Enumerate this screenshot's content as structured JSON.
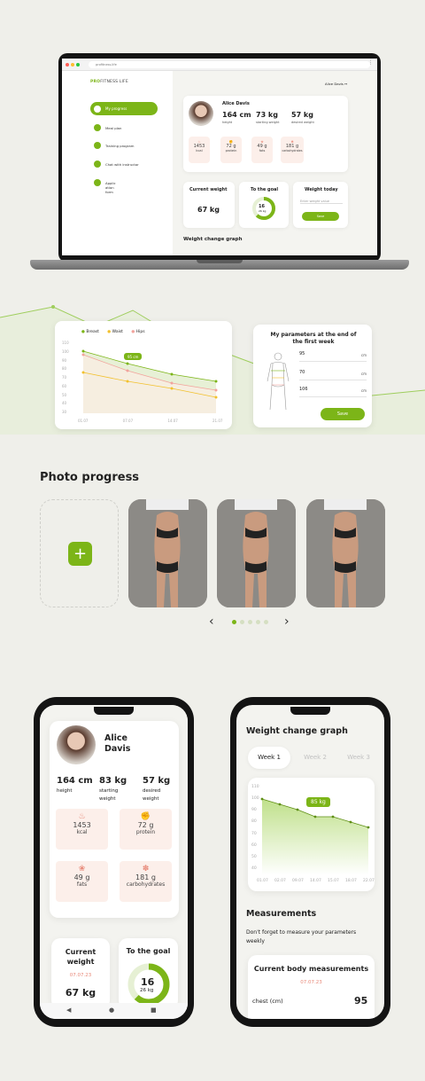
{
  "laptop": {
    "url": "profitness.life",
    "brand_prefix": "PRO",
    "brand_suffix": "FITNESS LIFE",
    "header_user": "Alice Davis",
    "nav": [
      "My progress",
      "Meal plan",
      "Training program",
      "Chat with instructor",
      "Applic\nation\nform"
    ],
    "profile": {
      "name": "Alice Davis",
      "stats": [
        {
          "value": "164 cm",
          "label": "height"
        },
        {
          "value": "73 kg",
          "label": "starting weight"
        },
        {
          "value": "57 kg",
          "label": "desired weight"
        }
      ],
      "nutrition": [
        {
          "value": "1453",
          "label": "kcal"
        },
        {
          "value": "72 g",
          "label": "protein"
        },
        {
          "value": "49 g",
          "label": "fats"
        },
        {
          "value": "181 g",
          "label": "carbohydrates"
        }
      ]
    },
    "current_weight": {
      "title": "Current weight",
      "value": "67 kg"
    },
    "goal": {
      "title": "To the goal",
      "value": "16",
      "sub": "26 kg",
      "fraction": 0.62
    },
    "weight_today": {
      "title": "Weight today",
      "placeholder": "Enter weight value",
      "button": "Save"
    },
    "graph_title": "Weight change graph"
  },
  "desk_chart": {
    "legend": [
      "Breast",
      "Waist",
      "Hips"
    ],
    "y_ticks": [
      "110",
      "100",
      "90",
      "80",
      "70",
      "60",
      "50",
      "40",
      "30"
    ],
    "x_ticks": [
      "01.07",
      "07.07",
      "14.07",
      "21.07"
    ],
    "tooltip": "95 cm"
  },
  "params": {
    "title": "My parameters at the end of the first week",
    "rows": [
      {
        "value": "95",
        "unit": "cm"
      },
      {
        "value": "70",
        "unit": "cm"
      },
      {
        "value": "106",
        "unit": "cm"
      }
    ],
    "save": "Save"
  },
  "photo_progress": {
    "title": "Photo progress",
    "add_symbol": "+",
    "prev": "‹",
    "next": "›",
    "dots": 5,
    "active_dot": 0
  },
  "phone1": {
    "name": "Alice\nDavis",
    "stats": [
      {
        "value": "164 cm",
        "label": "height"
      },
      {
        "value": "83 kg",
        "label": "starting\nweight"
      },
      {
        "value": "57 kg",
        "label": "desired\nweight"
      }
    ],
    "nutrition": [
      {
        "value": "1453",
        "label": "kcal"
      },
      {
        "value": "72 g",
        "label": "protein"
      },
      {
        "value": "49 g",
        "label": "fats"
      },
      {
        "value": "181 g",
        "label": "carbohydrates"
      }
    ],
    "current": {
      "title": "Current\nweight",
      "date": "07.07.23",
      "value": "67 kg"
    },
    "goal": {
      "title": "To the goal",
      "value": "16",
      "sub": "26 kg",
      "fraction": 0.62
    },
    "navbar": [
      "◀",
      "●",
      "■"
    ]
  },
  "phone2": {
    "title": "Weight change graph",
    "tabs": [
      "Week 1",
      "Week 2",
      "Week 3"
    ],
    "y_ticks": [
      "110",
      "100",
      "90",
      "80",
      "70",
      "60",
      "50",
      "40"
    ],
    "x_ticks": [
      "01.07",
      "02.07",
      "09.07",
      "14.07",
      "15.07",
      "18.07",
      "22.07"
    ],
    "tooltip": "85 kg",
    "measurements_title": "Measurements",
    "measurements_note": "Don't forget to measure your parameters weekly",
    "current_title": "Current body measurements",
    "current_date": "07.07.23",
    "row_label": "chest (cm)",
    "row_value": "95"
  },
  "colors": {
    "accent": "#7cb518",
    "bg": "#efefea",
    "nutrition_bg": "#fcefea"
  }
}
